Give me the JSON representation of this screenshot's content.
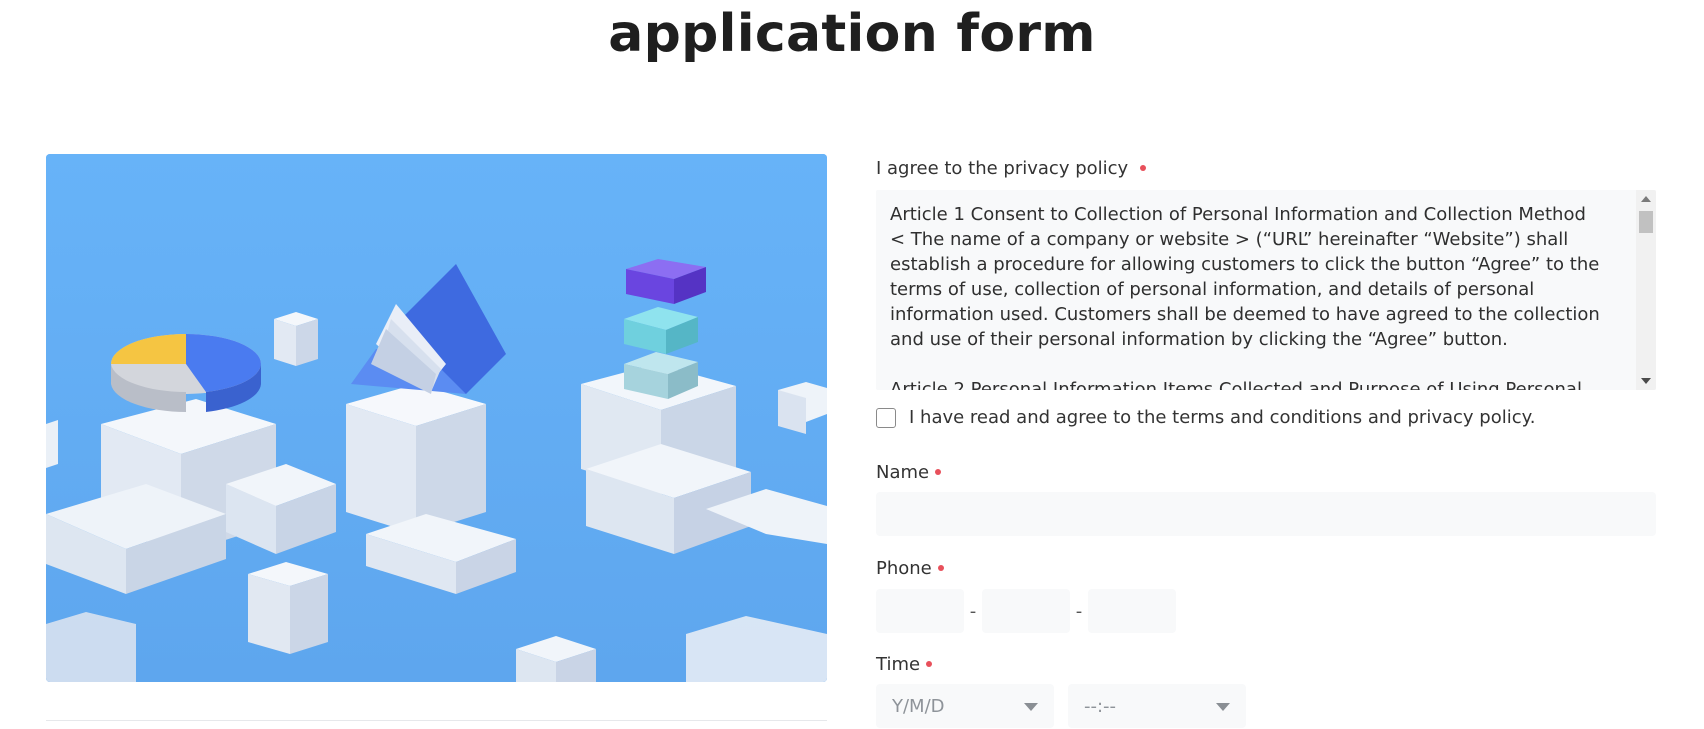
{
  "page": {
    "title": "application form"
  },
  "hero": {
    "alt": "3D illustration of charts and blocks"
  },
  "privacy": {
    "label": "I agree to the privacy policy",
    "text": "Article 1 Consent to Collection of Personal Information and Collection Method\n< The name of a company or website > (“URL” hereinafter “Website”) shall establish a procedure for allowing customers to click the button “Agree” to the terms of use, collection of personal information, and details of personal information used. Customers shall be deemed to have agreed to the collection and use of their personal information by clicking the “Agree” button.\n\nArticle 2 Personal Information Items Collected and Purpose of Using Personal",
    "agree_label": "I have read and agree to the terms and conditions and privacy policy."
  },
  "name": {
    "label": "Name",
    "placeholder": ""
  },
  "phone": {
    "label": "Phone",
    "separator": "-"
  },
  "time": {
    "label": "Time",
    "date_placeholder": "Y/M/D",
    "time_placeholder": "--:--"
  },
  "colors": {
    "required_dot": "#e8505b",
    "input_bg": "#f8f9fa",
    "hero_bg": "#63aef5"
  }
}
